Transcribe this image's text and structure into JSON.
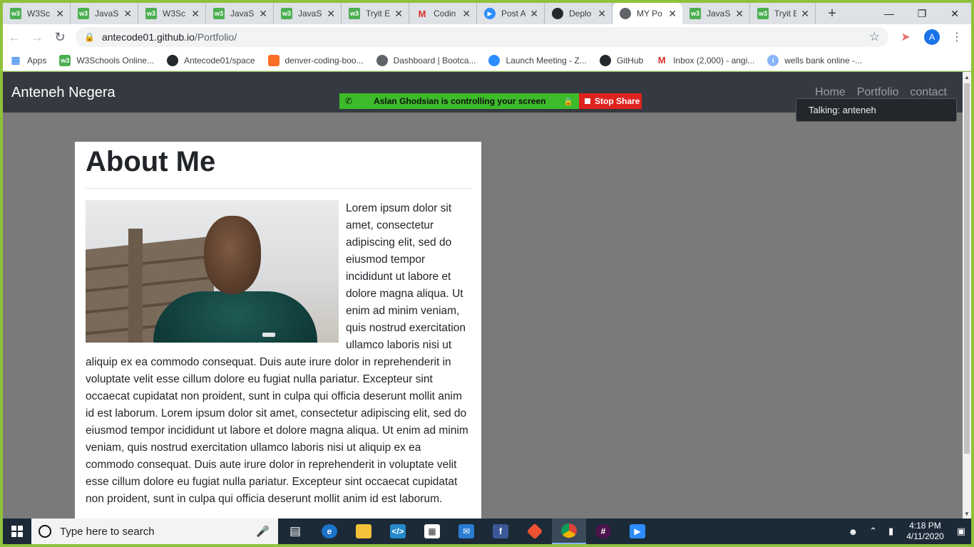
{
  "browser": {
    "tabs": [
      {
        "title": "W3Sc",
        "icon": "w3schools-icon",
        "active": false
      },
      {
        "title": "JavaSc",
        "icon": "w3schools-icon",
        "active": false
      },
      {
        "title": "W3Sc",
        "icon": "w3schools-icon",
        "active": false
      },
      {
        "title": "JavaSc",
        "icon": "w3schools-icon",
        "active": false
      },
      {
        "title": "JavaSc",
        "icon": "w3schools-icon",
        "active": false
      },
      {
        "title": "Tryit E",
        "icon": "w3schools-icon",
        "active": false
      },
      {
        "title": "Codin",
        "icon": "gmail-icon",
        "active": false
      },
      {
        "title": "Post A",
        "icon": "zoom-icon",
        "active": false
      },
      {
        "title": "Deplo",
        "icon": "github-icon",
        "active": false
      },
      {
        "title": "MY Po",
        "icon": "globe-icon",
        "active": true
      },
      {
        "title": "JavaSc",
        "icon": "w3schools-icon",
        "active": false
      },
      {
        "title": "Tryit E",
        "icon": "w3schools-icon",
        "active": false
      }
    ],
    "url_host": "antecode01.github.io",
    "url_path": "/Portfolio/",
    "profile_initial": "A",
    "bookmarks": [
      {
        "label": "Apps",
        "icon": "apps-grid-icon"
      },
      {
        "label": "W3Schools Online...",
        "icon": "w3schools-icon"
      },
      {
        "label": "Antecode01/space",
        "icon": "github-icon"
      },
      {
        "label": "denver-coding-boo...",
        "icon": "gitlab-icon"
      },
      {
        "label": "Dashboard | Bootca...",
        "icon": "globe-icon"
      },
      {
        "label": "Launch Meeting - Z...",
        "icon": "zoom-icon"
      },
      {
        "label": "GitHub",
        "icon": "github-icon"
      },
      {
        "label": "Inbox (2,000) - angi...",
        "icon": "gmail-icon"
      },
      {
        "label": "wells bank online -...",
        "icon": "info-icon"
      }
    ]
  },
  "site": {
    "brand": "Anteneh Negera",
    "nav": [
      "Home",
      "Portfolio",
      "contact"
    ],
    "heading": "About Me",
    "body": "Lorem ipsum dolor sit amet, consectetur adipiscing elit, sed do eiusmod tempor incididunt ut labore et dolore magna aliqua. Ut enim ad minim veniam, quis nostrud exercitation ullamco laboris nisi ut aliquip ex ea commodo consequat. Duis aute irure dolor in reprehenderit in voluptate velit esse cillum dolore eu fugiat nulla pariatur. Excepteur sint occaecat cupidatat non proident, sunt in culpa qui officia deserunt mollit anim id est laborum. Lorem ipsum dolor sit amet, consectetur adipiscing elit, sed do eiusmod tempor incididunt ut labore et dolore magna aliqua. Ut enim ad minim veniam, quis nostrud exercitation ullamco laboris nisi ut aliquip ex ea commodo consequat. Duis aute irure dolor in reprehenderit in voluptate velit esse cillum dolore eu fugiat nulla pariatur. Excepteur sint occaecat cupidatat non proident, sunt in culpa qui officia deserunt mollit anim id est laborum."
  },
  "zoom_share": {
    "status": "Aslan Ghodsian is controlling your screen",
    "stop_label": "Stop Share",
    "talking": "Talking: anteneh"
  },
  "taskbar": {
    "search_placeholder": "Type here to search",
    "time": "4:18 PM",
    "date": "4/11/2020"
  },
  "colors": {
    "share_frame": "#8fc23a",
    "navbar": "#343a40",
    "page_bg": "#7a7a7a",
    "share_green": "#3dbb2a",
    "share_red": "#e0221f"
  }
}
